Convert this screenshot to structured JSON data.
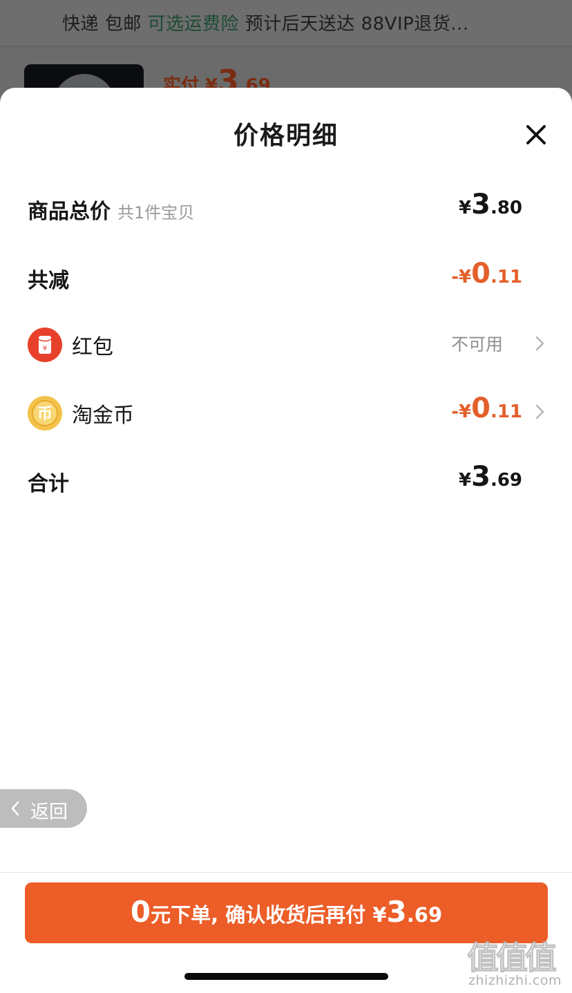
{
  "background": {
    "shipping_part1": "快递 包邮 ",
    "shipping_highlight": "可选运费险",
    "shipping_part2": " 预计后天送达 88VIP退货...",
    "price_label": "实付 ¥",
    "price_int": "3",
    "price_dec": ".69"
  },
  "sheet": {
    "title": "价格明细",
    "close_icon": "close-icon"
  },
  "rows": {
    "subtotal": {
      "label": "商品总价",
      "sub": "共1件宝贝",
      "yen": "¥",
      "int": "3",
      "dec": ".80"
    },
    "discount": {
      "label": "共减",
      "yen": "-¥",
      "int": "0",
      "dec": ".11"
    },
    "red_packet": {
      "label": "红包",
      "status": "不可用",
      "icon": "red-packet-icon"
    },
    "coins": {
      "label": "淘金币",
      "yen": "-¥",
      "int": "0",
      "dec": ".11",
      "icon": "gold-coin-icon"
    },
    "total": {
      "label": "合计",
      "yen": "¥",
      "int": "3",
      "dec": ".69"
    }
  },
  "back_button": {
    "label": "返回"
  },
  "order_button": {
    "zero": "0",
    "text": "元下单, 确认收货后再付 ",
    "yen": "¥",
    "int": "3",
    "dec": ".69"
  },
  "watermark": {
    "glyphs": "值值值",
    "url": "zhizhizhi.com"
  },
  "colors": {
    "accent": "#ec5d28",
    "discount": "#e35f2a",
    "highlight": "#1d4a34"
  }
}
